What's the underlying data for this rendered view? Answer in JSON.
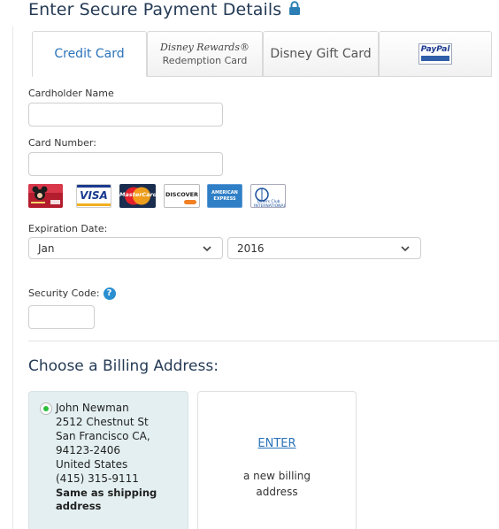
{
  "header": {
    "title": "Enter Secure Payment Details",
    "lock_icon": "lock-icon"
  },
  "tabs": [
    {
      "label": "Credit Card",
      "active": true
    },
    {
      "label_line1": "Disney Rewards®",
      "label_line2": "Redemption Card"
    },
    {
      "label": "Disney Gift Card"
    },
    {
      "label": "PayPal",
      "icon": "paypal-logo"
    }
  ],
  "form": {
    "cardholder_label": "Cardholder Name",
    "cardholder_value": "",
    "card_number_label": "Card Number:",
    "card_number_value": "",
    "accepted_cards": [
      {
        "name": "disney-rewards-visa",
        "text": ""
      },
      {
        "name": "visa",
        "text": "VISA"
      },
      {
        "name": "mastercard",
        "text": "MasterCard"
      },
      {
        "name": "discover",
        "text": "DISCOVER"
      },
      {
        "name": "american-express",
        "text": "AMERICAN EXPRESS"
      },
      {
        "name": "diners-club",
        "text": "Diners Club INTERNATIONAL"
      }
    ],
    "expiration_label": "Expiration Date:",
    "exp_month": "Jan",
    "exp_year": "2016",
    "security_label": "Security Code:",
    "security_help": "?",
    "security_value": ""
  },
  "billing": {
    "title": "Choose a Billing Address:",
    "saved_address": {
      "selected": true,
      "name": "John Newman",
      "street": "2512 Chestnut St",
      "city_state": "San Francisco CA,",
      "zip": "94123-2406",
      "country": "United States",
      "phone": "(415) 315-9111",
      "note_line1": "Same as shipping",
      "note_line2": "address"
    },
    "new_address": {
      "link": "ENTER",
      "line1": "a new billing",
      "line2": "address"
    }
  },
  "colors": {
    "title": "#253b56",
    "link": "#2a73b9",
    "selected_bg": "#e3eff0",
    "radio_selected": "#2bbf3b"
  }
}
